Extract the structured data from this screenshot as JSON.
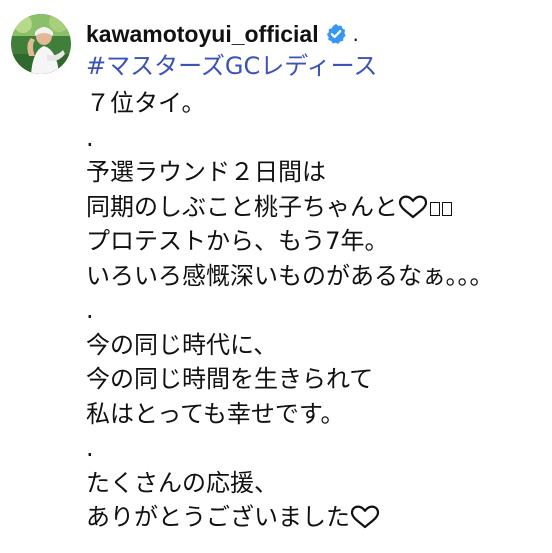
{
  "post": {
    "username": "kawamotoyui_official",
    "verified_icon": "verified-badge-icon",
    "separator": ".",
    "hashtag": "#マスターズGCレディース",
    "caption_lines": [
      "７位タイ。",
      ".",
      "予選ラウンド２日間は",
      "同期のしぶこと桃子ちゃんと",
      "プロテストから、もう7年。",
      "いろいろ感慨深いものがあるなぁ。。。",
      ".",
      "今の同じ時代に、",
      "今の同じ時間を生きられて",
      "私はとっても幸せです。",
      ".",
      "たくさんの応援、",
      "ありがとうございました"
    ],
    "emoji": {
      "line4": "white-heart-icon",
      "line13": "white-heart-icon"
    },
    "colors": {
      "hashtag": "#3b52b8",
      "verified": "#3897f0",
      "text": "#111111"
    }
  }
}
